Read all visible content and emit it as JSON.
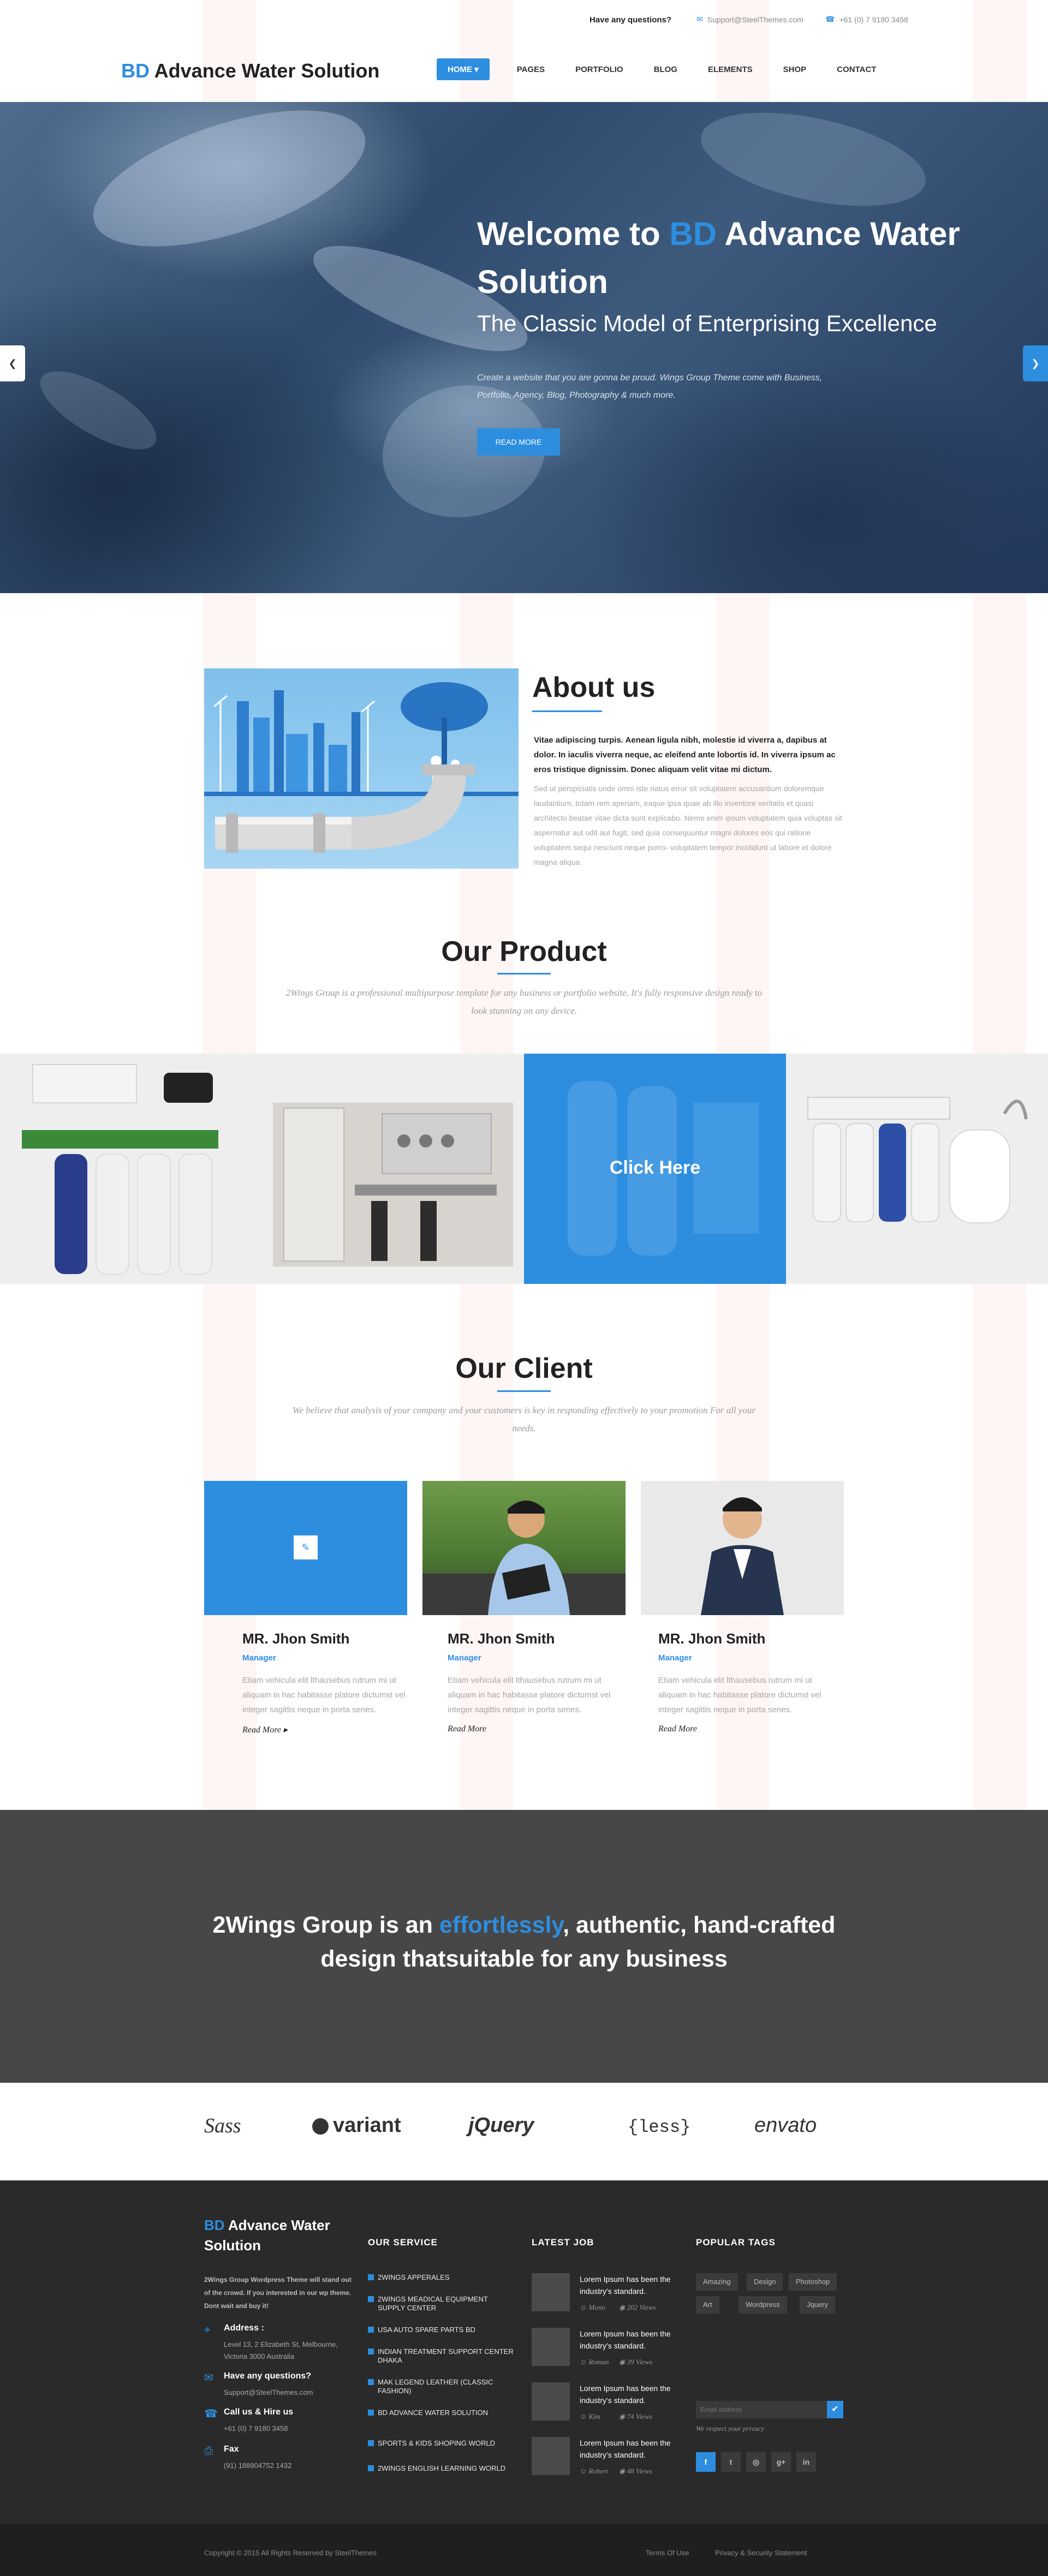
{
  "topbar": {
    "question": "Have any questions?",
    "email": "Support@SteelThemes.com",
    "phone": "+61 (0) 7 9180 3458"
  },
  "header": {
    "logo_prefix": "BD",
    "logo_rest": " Advance Water Solution",
    "nav": [
      "HOME ▾",
      "PAGES",
      "PORTFOLIO",
      "BLOG",
      "ELEMENTS",
      "SHOP",
      "CONTACT"
    ]
  },
  "hero": {
    "title_prefix": "Welcome to ",
    "title_bd": "BD",
    "title_rest": " Advance Water Solution",
    "subtitle": "The Classic Model of Enterprising Excellence",
    "description": "Create a website that you are gonna be proud. Wings Group Theme come with Business, Portfolio, Agency, Blog, Photography & much more.",
    "button": "READ MORE",
    "prev_icon": "❮",
    "next_icon": "❯"
  },
  "about": {
    "title": "About us",
    "bold_text": "Vitae adipiscing turpis. Aenean ligula nibh, molestie id viverra a, dapibus at dolor. In iaculis viverra neque, ac eleifend ante lobortis id. In viverra ipsum ac eros tristique dignissim. Donec aliquam velit vitae mi dictum.",
    "text": "Sed ut perspiciatis unde omni iste natus error sit voluptatem accusantium doloremque laudantium, totam rem aperiam, eaque ipsa quae ab illo inventore veritatis et quasi architecto beatae vitae dicta sunt explicabo. Nemo enim ipsum voluptatem quia voluptas sit aspernatur aut odit aut fugit, sed quia consequuntur magni dolores eos qui ratione voluptatem sequi nesciunt neque porro- voluptatem tempor incididunt ut labore et dolore magna aliqua."
  },
  "product": {
    "title": "Our Product",
    "subtitle": "2Wings Group is a professional multipurpose template for any business or portfolio website. It's fully responsive design ready to look stunning on any device.",
    "click_label": "Click Here"
  },
  "client": {
    "title": "Our Client",
    "subtitle": "We believe that analysis of your company and your customers is key in responding effectively to your promotion For all your needs.",
    "link_icon": "✎",
    "members": [
      {
        "name": "MR. Jhon Smith",
        "role": "Manager",
        "text": "Etiam vehicula elit lthausebus rutrum mi ut aliquam in hac habitasse platore dictumst vel integer sagittis neque in porta senes.",
        "more": "Read More ▸"
      },
      {
        "name": "MR. Jhon Smith",
        "role": "Manager",
        "text": "Etiam vehicula elit lthausebus rutrum mi ut aliquam in hac habitasse platore dictumst vel integer sagittis neque in porta senes.",
        "more": "Read More"
      },
      {
        "name": "MR. Jhon Smith",
        "role": "Manager",
        "text": "Etiam vehicula elit lthausebus rutrum mi ut aliquam in hac habitasse platore dictumst vel integer sagittis neque in porta senes.",
        "more": "Read More"
      }
    ]
  },
  "banner": {
    "prefix": "2Wings Group is an ",
    "highlight": "effortlessly",
    "rest": ", authentic, hand-crafted design thatsuitable for any business"
  },
  "partners": [
    "Sass",
    "variant",
    "jQuery",
    "{less}",
    "envato"
  ],
  "footer": {
    "brand_prefix": "BD",
    "brand_rest": " Advance Water Solution",
    "intro": "2Wings Group  Wordpress Theme will stand out of the crowd. If you interested in our wp theme. Dont wait and buy it!",
    "contacts": [
      {
        "icon": "⌖",
        "label": "Address :",
        "value": "Level 13, 2 Elizabeth St, Melbourne, Victoria 3000 Australia"
      },
      {
        "icon": "✉",
        "label": "Have any questions?",
        "value": "Support@SteelThemes.com"
      },
      {
        "icon": "☎",
        "label": "Call us & Hire us",
        "value": "+61 (0) 7 9180 3458"
      },
      {
        "icon": "⎙",
        "label": "Fax",
        "value": "(91) 188904752 1432"
      }
    ],
    "service_head": "OUR SERVICE",
    "services": [
      "2WINGS APPERALES",
      "2WINGS MEADICAL EQUIPMENT SUPPLY CENTER",
      "USA AUTO SPARE PARTS BD",
      "INDIAN TREATMENT SUPPORT CENTER DHAKA",
      "MAK LEGEND LEATHER (CLASSIC FASHION)",
      "BD ADVANCE WATER SOLUTION",
      "SPORTS & KIDS SHOPING WORLD",
      "2WINGS ENGLISH LEARNING WORLD"
    ],
    "job_head": "LATEST JOB",
    "jobs": [
      {
        "title": "Lorem Ipsum has been the industry's standard.",
        "by": "☺ Mono",
        "views": "◉ 202 Views"
      },
      {
        "title": "Lorem Ipsum has been the industry's standard.",
        "by": "☺ Roman",
        "views": "◉ 39 Views"
      },
      {
        "title": "Lorem Ipsum has been the industry's standard.",
        "by": "☺ Kim",
        "views": "◉ 74 Views"
      },
      {
        "title": "Lorem Ipsum has been the industry's standard.",
        "by": "☺ Robert",
        "views": "◉ 48 Views"
      }
    ],
    "tag_head": "POPULAR TAGS",
    "tags": [
      "Amazing",
      "Design",
      "Photoshop",
      "Art",
      "Wordpress",
      "Jquery"
    ],
    "email_placeholder": "Email address",
    "submit_icon": "✔",
    "respect": "We respect your privacy",
    "social": [
      "f",
      "t",
      "◎",
      "g+",
      "in"
    ],
    "copyright": "Copyright © 2015 All Rights Reserved by SteelThemes",
    "terms": "Terms Of Use",
    "privacy": "Privacy & Security Statement"
  },
  "colors": {
    "accent": "#2d8ee0",
    "dark": "#2a2a2a",
    "banner": "#474747"
  }
}
